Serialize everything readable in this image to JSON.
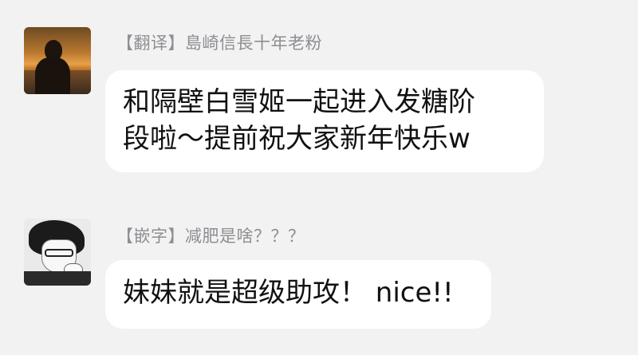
{
  "messages": [
    {
      "tag": "【翻译】",
      "sender": "島崎信長十年老粉",
      "avatar_icon": "sunset-silhouette-avatar",
      "lines": [
        "和隔壁白雪姬一起进入发糖阶",
        "段啦～提前祝大家新年快乐w"
      ]
    },
    {
      "tag": "【嵌字】",
      "sender": "减肥是啥？？？",
      "avatar_icon": "manga-character-avatar",
      "lines": [
        "妹妹就是超级助攻！ nice!!"
      ]
    }
  ],
  "colors": {
    "background": "#f2f2f2",
    "bubble": "#ffffff",
    "name_text": "#8e8e93",
    "message_text": "#111111"
  }
}
